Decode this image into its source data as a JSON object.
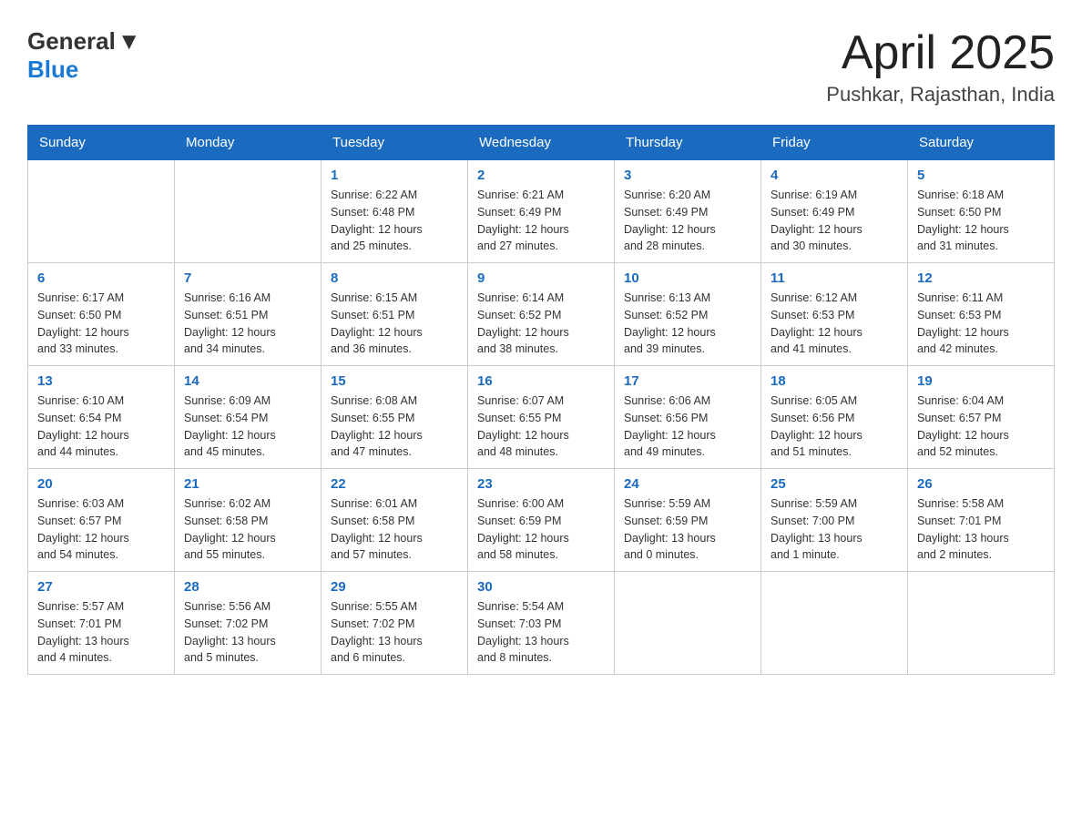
{
  "header": {
    "logo_general": "General",
    "logo_blue": "Blue",
    "title": "April 2025",
    "subtitle": "Pushkar, Rajasthan, India"
  },
  "days_of_week": [
    "Sunday",
    "Monday",
    "Tuesday",
    "Wednesday",
    "Thursday",
    "Friday",
    "Saturday"
  ],
  "weeks": [
    [
      {
        "day": "",
        "info": ""
      },
      {
        "day": "",
        "info": ""
      },
      {
        "day": "1",
        "info": "Sunrise: 6:22 AM\nSunset: 6:48 PM\nDaylight: 12 hours\nand 25 minutes."
      },
      {
        "day": "2",
        "info": "Sunrise: 6:21 AM\nSunset: 6:49 PM\nDaylight: 12 hours\nand 27 minutes."
      },
      {
        "day": "3",
        "info": "Sunrise: 6:20 AM\nSunset: 6:49 PM\nDaylight: 12 hours\nand 28 minutes."
      },
      {
        "day": "4",
        "info": "Sunrise: 6:19 AM\nSunset: 6:49 PM\nDaylight: 12 hours\nand 30 minutes."
      },
      {
        "day": "5",
        "info": "Sunrise: 6:18 AM\nSunset: 6:50 PM\nDaylight: 12 hours\nand 31 minutes."
      }
    ],
    [
      {
        "day": "6",
        "info": "Sunrise: 6:17 AM\nSunset: 6:50 PM\nDaylight: 12 hours\nand 33 minutes."
      },
      {
        "day": "7",
        "info": "Sunrise: 6:16 AM\nSunset: 6:51 PM\nDaylight: 12 hours\nand 34 minutes."
      },
      {
        "day": "8",
        "info": "Sunrise: 6:15 AM\nSunset: 6:51 PM\nDaylight: 12 hours\nand 36 minutes."
      },
      {
        "day": "9",
        "info": "Sunrise: 6:14 AM\nSunset: 6:52 PM\nDaylight: 12 hours\nand 38 minutes."
      },
      {
        "day": "10",
        "info": "Sunrise: 6:13 AM\nSunset: 6:52 PM\nDaylight: 12 hours\nand 39 minutes."
      },
      {
        "day": "11",
        "info": "Sunrise: 6:12 AM\nSunset: 6:53 PM\nDaylight: 12 hours\nand 41 minutes."
      },
      {
        "day": "12",
        "info": "Sunrise: 6:11 AM\nSunset: 6:53 PM\nDaylight: 12 hours\nand 42 minutes."
      }
    ],
    [
      {
        "day": "13",
        "info": "Sunrise: 6:10 AM\nSunset: 6:54 PM\nDaylight: 12 hours\nand 44 minutes."
      },
      {
        "day": "14",
        "info": "Sunrise: 6:09 AM\nSunset: 6:54 PM\nDaylight: 12 hours\nand 45 minutes."
      },
      {
        "day": "15",
        "info": "Sunrise: 6:08 AM\nSunset: 6:55 PM\nDaylight: 12 hours\nand 47 minutes."
      },
      {
        "day": "16",
        "info": "Sunrise: 6:07 AM\nSunset: 6:55 PM\nDaylight: 12 hours\nand 48 minutes."
      },
      {
        "day": "17",
        "info": "Sunrise: 6:06 AM\nSunset: 6:56 PM\nDaylight: 12 hours\nand 49 minutes."
      },
      {
        "day": "18",
        "info": "Sunrise: 6:05 AM\nSunset: 6:56 PM\nDaylight: 12 hours\nand 51 minutes."
      },
      {
        "day": "19",
        "info": "Sunrise: 6:04 AM\nSunset: 6:57 PM\nDaylight: 12 hours\nand 52 minutes."
      }
    ],
    [
      {
        "day": "20",
        "info": "Sunrise: 6:03 AM\nSunset: 6:57 PM\nDaylight: 12 hours\nand 54 minutes."
      },
      {
        "day": "21",
        "info": "Sunrise: 6:02 AM\nSunset: 6:58 PM\nDaylight: 12 hours\nand 55 minutes."
      },
      {
        "day": "22",
        "info": "Sunrise: 6:01 AM\nSunset: 6:58 PM\nDaylight: 12 hours\nand 57 minutes."
      },
      {
        "day": "23",
        "info": "Sunrise: 6:00 AM\nSunset: 6:59 PM\nDaylight: 12 hours\nand 58 minutes."
      },
      {
        "day": "24",
        "info": "Sunrise: 5:59 AM\nSunset: 6:59 PM\nDaylight: 13 hours\nand 0 minutes."
      },
      {
        "day": "25",
        "info": "Sunrise: 5:59 AM\nSunset: 7:00 PM\nDaylight: 13 hours\nand 1 minute."
      },
      {
        "day": "26",
        "info": "Sunrise: 5:58 AM\nSunset: 7:01 PM\nDaylight: 13 hours\nand 2 minutes."
      }
    ],
    [
      {
        "day": "27",
        "info": "Sunrise: 5:57 AM\nSunset: 7:01 PM\nDaylight: 13 hours\nand 4 minutes."
      },
      {
        "day": "28",
        "info": "Sunrise: 5:56 AM\nSunset: 7:02 PM\nDaylight: 13 hours\nand 5 minutes."
      },
      {
        "day": "29",
        "info": "Sunrise: 5:55 AM\nSunset: 7:02 PM\nDaylight: 13 hours\nand 6 minutes."
      },
      {
        "day": "30",
        "info": "Sunrise: 5:54 AM\nSunset: 7:03 PM\nDaylight: 13 hours\nand 8 minutes."
      },
      {
        "day": "",
        "info": ""
      },
      {
        "day": "",
        "info": ""
      },
      {
        "day": "",
        "info": ""
      }
    ]
  ],
  "colors": {
    "header_bg": "#1a6bbf",
    "header_text": "#ffffff",
    "day_number": "#1a6bbf",
    "border": "#cccccc"
  }
}
